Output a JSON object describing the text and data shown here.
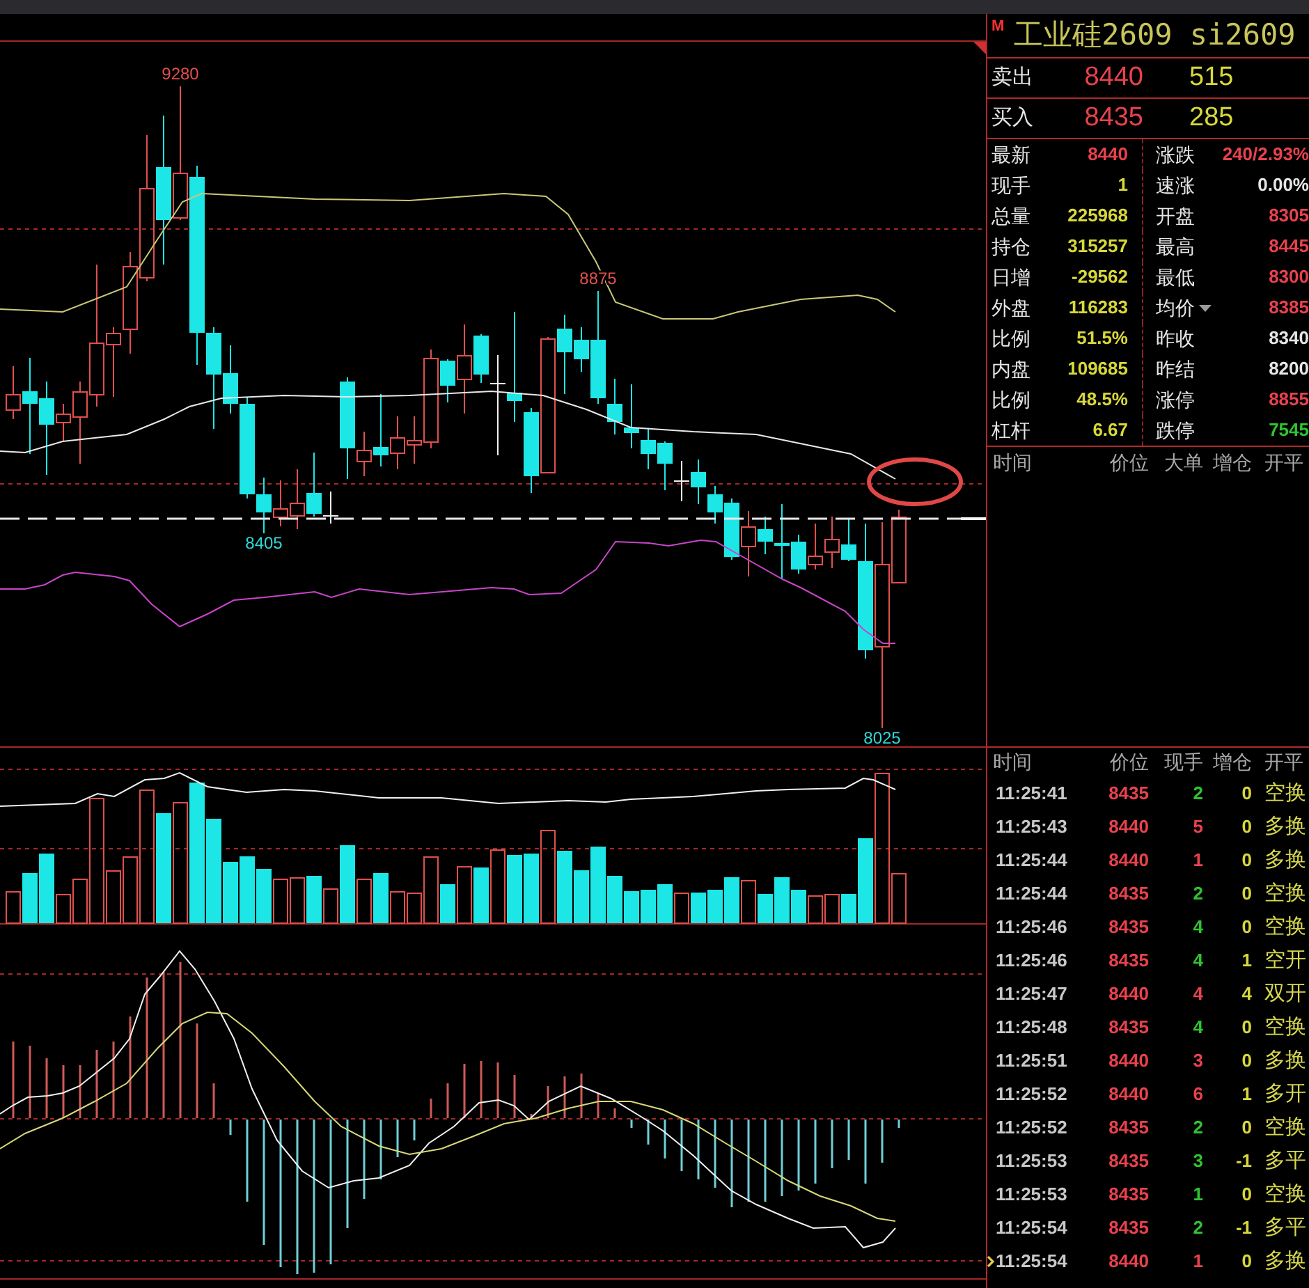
{
  "chart": {
    "price_labels": [
      {
        "kind": "high",
        "text": "9280"
      },
      {
        "kind": "low",
        "text": "8405"
      },
      {
        "kind": "high",
        "text": "8875"
      },
      {
        "kind": "low",
        "text": "8025"
      }
    ]
  },
  "quote": {
    "market_flag": "M",
    "title": "工业硅2609 si2609",
    "book": [
      {
        "label": "卖出",
        "price": "8440",
        "volume": "515"
      },
      {
        "label": "买入",
        "price": "8435",
        "volume": "285"
      }
    ],
    "stats": [
      {
        "label": "最新",
        "value": "8440",
        "color": "#e8424d",
        "kind": "plain"
      },
      {
        "label": "涨跌",
        "value": "240/2.93%",
        "color": "#e8424d",
        "kind": "plain"
      },
      {
        "label": "现手",
        "value": "1",
        "color": "#d8d83a",
        "kind": "plain"
      },
      {
        "label": "速涨",
        "value": "0.00%",
        "color": "#e6e6e6",
        "kind": "plain"
      },
      {
        "label": "总量",
        "value": "225968",
        "color": "#d8d83a",
        "kind": "plain"
      },
      {
        "label": "开盘",
        "value": "8305",
        "color": "#e8424d",
        "kind": "plain"
      },
      {
        "label": "持仓",
        "value": "315257",
        "color": "#d8d83a",
        "kind": "plain"
      },
      {
        "label": "最高",
        "value": "8445",
        "color": "#e8424d",
        "kind": "plain"
      },
      {
        "label": "日增",
        "value": "-29562",
        "color": "#d8d83a",
        "kind": "plain"
      },
      {
        "label": "最低",
        "value": "8300",
        "color": "#e8424d",
        "kind": "plain"
      },
      {
        "label": "外盘",
        "value": "116283",
        "color": "#d8d83a",
        "kind": "plain"
      },
      {
        "label": "均价",
        "value": "8385",
        "color": "#e8424d",
        "kind": "dropdown"
      },
      {
        "label": "比例",
        "value": "51.5%",
        "color": "#d8d83a",
        "kind": "plain"
      },
      {
        "label": "昨收",
        "value": "8340",
        "color": "#e6e6e6",
        "kind": "plain"
      },
      {
        "label": "内盘",
        "value": "109685",
        "color": "#d8d83a",
        "kind": "plain"
      },
      {
        "label": "昨结",
        "value": "8200",
        "color": "#e6e6e6",
        "kind": "plain"
      },
      {
        "label": "比例",
        "value": "48.5%",
        "color": "#d8d83a",
        "kind": "plain"
      },
      {
        "label": "涨停",
        "value": "8855",
        "color": "#e8424d",
        "kind": "plain"
      },
      {
        "label": "杠杆",
        "value": "6.67",
        "color": "#d8d83a",
        "kind": "plain"
      },
      {
        "label": "跌停",
        "value": "7545",
        "color": "#2fc42f",
        "kind": "plain"
      }
    ]
  },
  "big_orders": {
    "columns": [
      "时间",
      "价位",
      "大单",
      "增仓",
      "开平"
    ]
  },
  "trades": {
    "columns": [
      "时间",
      "价位",
      "现手",
      "增仓",
      "开平"
    ],
    "rows": [
      {
        "time": "11:25:41",
        "price": "8435",
        "hand": "2",
        "oi": "0",
        "type": "空换",
        "color": "#2fc42f",
        "current": false
      },
      {
        "time": "11:25:43",
        "price": "8440",
        "hand": "5",
        "oi": "0",
        "type": "多换",
        "color": "#e8424d",
        "current": false
      },
      {
        "time": "11:25:44",
        "price": "8440",
        "hand": "1",
        "oi": "0",
        "type": "多换",
        "color": "#e8424d",
        "current": false
      },
      {
        "time": "11:25:44",
        "price": "8435",
        "hand": "2",
        "oi": "0",
        "type": "空换",
        "color": "#2fc42f",
        "current": false
      },
      {
        "time": "11:25:46",
        "price": "8435",
        "hand": "4",
        "oi": "0",
        "type": "空换",
        "color": "#2fc42f",
        "current": false
      },
      {
        "time": "11:25:46",
        "price": "8435",
        "hand": "4",
        "oi": "1",
        "type": "空开",
        "color": "#2fc42f",
        "current": false
      },
      {
        "time": "11:25:47",
        "price": "8440",
        "hand": "4",
        "oi": "4",
        "type": "双开",
        "color": "#e8424d",
        "current": false
      },
      {
        "time": "11:25:48",
        "price": "8435",
        "hand": "4",
        "oi": "0",
        "type": "空换",
        "color": "#2fc42f",
        "current": false
      },
      {
        "time": "11:25:51",
        "price": "8440",
        "hand": "3",
        "oi": "0",
        "type": "多换",
        "color": "#e8424d",
        "current": false
      },
      {
        "time": "11:25:52",
        "price": "8440",
        "hand": "6",
        "oi": "1",
        "type": "多开",
        "color": "#e8424d",
        "current": false
      },
      {
        "time": "11:25:52",
        "price": "8435",
        "hand": "2",
        "oi": "0",
        "type": "空换",
        "color": "#2fc42f",
        "current": false
      },
      {
        "time": "11:25:53",
        "price": "8435",
        "hand": "3",
        "oi": "-1",
        "type": "多平",
        "color": "#2fc42f",
        "current": false
      },
      {
        "time": "11:25:53",
        "price": "8435",
        "hand": "1",
        "oi": "0",
        "type": "空换",
        "color": "#2fc42f",
        "current": false
      },
      {
        "time": "11:25:54",
        "price": "8435",
        "hand": "2",
        "oi": "-1",
        "type": "多平",
        "color": "#2fc42f",
        "current": false
      },
      {
        "time": "11:25:54",
        "price": "8440",
        "hand": "1",
        "oi": "0",
        "type": "多换",
        "color": "#e8424d",
        "current": true
      }
    ]
  }
}
